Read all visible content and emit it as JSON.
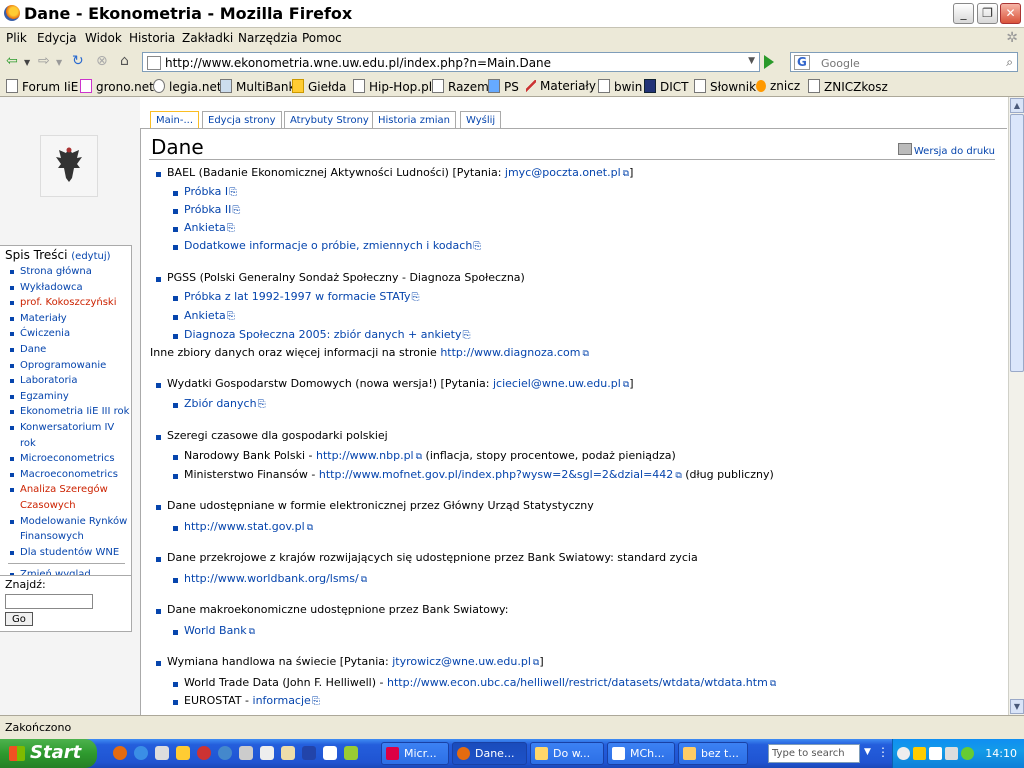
{
  "window": {
    "title": "Dane - Ekonometria - Mozilla Firefox"
  },
  "menu": [
    "Plik",
    "Edycja",
    "Widok",
    "Historia",
    "Zakładki",
    "Narzędzia",
    "Pomoc"
  ],
  "nav": {
    "url": "http://www.ekonometria.wne.uw.edu.pl/index.php?n=Main.Dane",
    "search_placeholder": "Google"
  },
  "bookmarks": [
    "Forum IiE",
    "grono.net",
    "legia.net",
    "MultiBank",
    "Giełda",
    "Hip-Hop.pl",
    "Razem",
    "PS",
    "Materiały",
    "bwin",
    "DICT",
    "Słownik",
    "znicz",
    "ZNICZkosz"
  ],
  "sidebar": {
    "toc_title": "Spis Treści",
    "toc_edit": "(edytuj)",
    "items": [
      "Strona główna",
      "Wykładowca",
      "prof. Kokoszczyński",
      "Materiały",
      "Ćwiczenia",
      "Dane",
      "Oprogramowanie",
      "Laboratoria",
      "Egzaminy",
      "Ekonometria IiE III rok",
      "Konwersatorium IV rok",
      "Microeconometrics",
      "Macroeconometrics",
      "Analiza Szeregów",
      "Czasowych",
      "Modelowanie Rynków",
      "Finansowych",
      "Dla studentów WNE"
    ],
    "skin": "Zmień wygląd",
    "find_label": "Znajdź:",
    "go": "Go"
  },
  "tabs": [
    "Main-...",
    "Edycja strony",
    "Atrybuty Strony",
    "Historia zmian",
    "Wyślij"
  ],
  "page": {
    "title": "Dane",
    "print": "Wersja do druku",
    "s1": {
      "text": "BAEL (Badanie Ekonomicznej Aktywności Ludności) [Pytania: ",
      "email": "jmyc@poczta.onet.pl",
      "close": "]",
      "items": [
        "Próbka I",
        "Próbka II",
        "Ankieta",
        "Dodatkowe informacje o próbie, zmiennych i kodach"
      ]
    },
    "s2": {
      "text": "PGSS (Polski Generalny Sondaż Społeczny - Diagnoza Społeczna)",
      "items": [
        "Próbka z lat 1992-1997 w formacie STATy",
        "Ankieta",
        "Diagnoza Społeczna 2005: zbiór danych + ankiety"
      ],
      "more_text": "Inne zbiory danych oraz więcej informacji na stronie ",
      "more_link": "http://www.diagnoza.com"
    },
    "s3": {
      "text": "Wydatki Gospodarstw Domowych (nowa wersja!) [Pytania: ",
      "email": "jcieciel@wne.uw.edu.pl",
      "close": "]",
      "items": [
        "Zbiór danych"
      ]
    },
    "s4": {
      "text": "Szeregi czasowe dla gospodarki polskiej",
      "nbp_text": "Narodowy Bank Polski - ",
      "nbp_link": "http://www.nbp.pl",
      "nbp_note": " (inflacja, stopy procentowe, podaż pieniądza)",
      "mf_text": "Ministerstwo Finansów - ",
      "mf_link": "http://www.mofnet.gov.pl/index.php?wysw=2&sgl=2&dzial=442",
      "mf_note": " (dług publiczny)"
    },
    "s5": {
      "text": "Dane udostępniane w formie elektronicznej przez Główny Urząd Statystyczny",
      "link": "http://www.stat.gov.pl"
    },
    "s6": {
      "text": "Dane przekrojowe z krajów rozwijających się udostępnione przez Bank Swiatowy: standard zycia",
      "link": "http://www.worldbank.org/lsms/"
    },
    "s7": {
      "text": "Dane makroekonomiczne udostępnione przez Bank Swiatowy:",
      "link": "World Bank"
    },
    "s8": {
      "text": "Wymiana handlowa na świecie [Pytania: ",
      "email": "jtyrowicz@wne.uw.edu.pl",
      "close": "]",
      "wtd_text": "World Trade Data (John F. Helliwell) - ",
      "wtd_link": "http://www.econ.ubc.ca/helliwell/restrict/datasets/wtdata/wtdata.htm",
      "eu_text": "EUROSTAT - ",
      "eu_link": "informacje"
    }
  },
  "status": "Zakończono",
  "taskbar": {
    "start": "Start",
    "tasks": [
      "Micr...",
      "Dane...",
      "Do w...",
      "MCh...",
      "bez t..."
    ],
    "search_placeholder": "Type to search",
    "clock": "14:10"
  }
}
